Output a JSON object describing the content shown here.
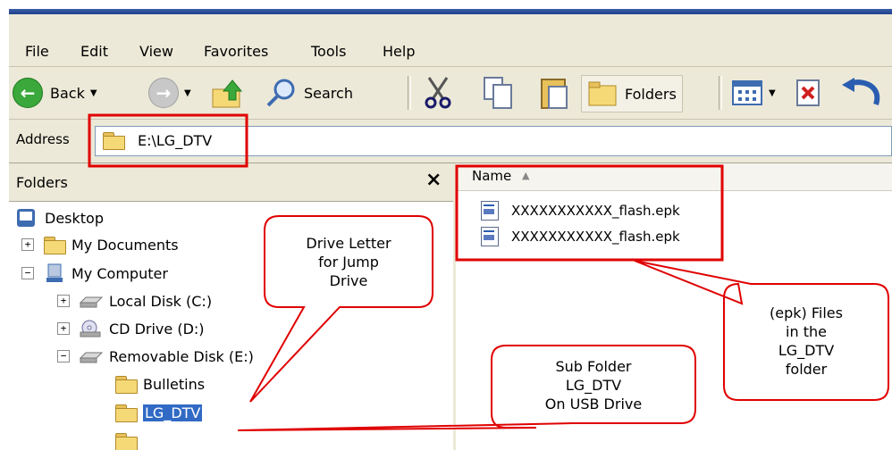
{
  "menu": {
    "items": [
      "File",
      "Edit",
      "View",
      "Favorites",
      "Tools",
      "Help"
    ]
  },
  "toolbar": {
    "back_label": "Back",
    "search_label": "Search",
    "folders_label": "Folders",
    "icons": [
      "back-arrow-icon",
      "forward-arrow-icon",
      "up-folder-icon",
      "search-icon",
      "cut-icon",
      "copy-icon",
      "paste-icon",
      "folders-icon",
      "views-icon",
      "delete-icon",
      "undo-icon"
    ]
  },
  "address": {
    "label": "Address",
    "value": "E:\\LG_DTV"
  },
  "folders_pane": {
    "title": "Folders",
    "close": "×",
    "tree": [
      {
        "label": "Desktop",
        "icon": "desktop-icon"
      },
      {
        "label": "My Documents",
        "icon": "documents-folder-icon",
        "expander": "+"
      },
      {
        "label": "My Computer",
        "icon": "computer-icon",
        "expander": "−"
      },
      {
        "label": "Local Disk (C:)",
        "icon": "hard-disk-icon",
        "expander": "+"
      },
      {
        "label": "CD Drive (D:)",
        "icon": "cd-drive-icon",
        "expander": "+"
      },
      {
        "label": "Removable Disk (E:)",
        "icon": "removable-disk-icon",
        "expander": "−"
      },
      {
        "label": "Bulletins",
        "icon": "folder-icon"
      },
      {
        "label": "LG_DTV",
        "icon": "open-folder-icon",
        "selected": true
      }
    ]
  },
  "files_pane": {
    "column_name": "Name",
    "files": [
      "XXXXXXXXXXX_flash.epk",
      "XXXXXXXXXXX_flash.epk"
    ]
  },
  "callouts": {
    "drive_letter": "Drive Letter\nfor Jump\nDrive",
    "sub_folder": "Sub Folder\nLG_DTV\nOn USB Drive",
    "epk_files": "(epk) Files\nin the\nLG_DTV\nfolder"
  },
  "colors": {
    "annotation_red": "#e00000",
    "selection_blue": "#316ac5",
    "xp_toolbar": "#ece9d8"
  }
}
